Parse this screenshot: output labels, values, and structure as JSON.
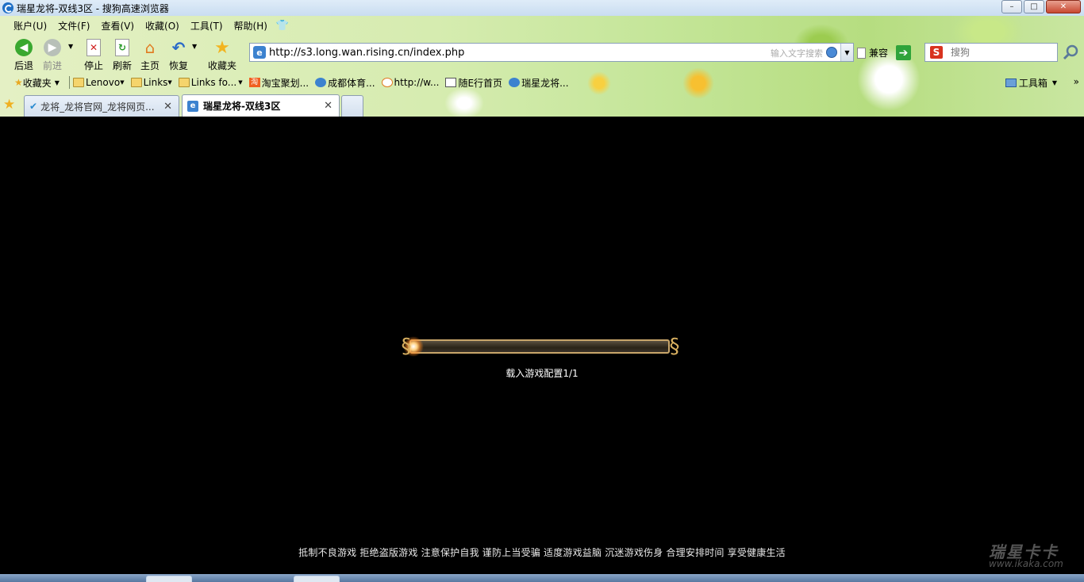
{
  "window": {
    "title": "瑞星龙将-双线3区 - 搜狗高速浏览器",
    "min_label": "–",
    "max_label": "□",
    "close_label": "✕"
  },
  "menu": [
    "账户(U)",
    "文件(F)",
    "查看(V)",
    "收藏(O)",
    "工具(T)",
    "帮助(H)"
  ],
  "nav": {
    "back": "后退",
    "forward": "前进",
    "stop": "停止",
    "refresh": "刷新",
    "home": "主页",
    "restore": "恢复",
    "favorites": "收藏夹"
  },
  "address": {
    "url": "http://s3.long.wan.rising.cn/index.php",
    "search_hint": "输入文字搜索"
  },
  "compat_label": "兼容",
  "search": {
    "placeholder": "搜狗",
    "logo": "S"
  },
  "bookmarks": {
    "favorites": "收藏夹",
    "items": [
      "Lenovo",
      "Links",
      "Links fo...",
      "淘宝聚划...",
      "成都体育...",
      "http://w...",
      "随E行首页",
      "瑞星龙将..."
    ],
    "toolbox": "工具箱"
  },
  "tabs": [
    {
      "label": "龙将_龙将官网_龙将网页..."
    },
    {
      "label": "瑞星龙将-双线3区"
    }
  ],
  "game": {
    "progress": 0.0,
    "loading_text": "载入游戏配置1/1",
    "health_notice": "抵制不良游戏  拒绝盗版游戏  注意保护自我  谨防上当受骗  适度游戏益脑  沉迷游戏伤身  合理安排时间  享受健康生活"
  },
  "watermark": {
    "title": "瑞星卡卡",
    "url": "www.ikaka.com"
  },
  "colors": {
    "loader_border": "#c9a66a",
    "content_bg": "#000000",
    "go_button": "#2fa33a"
  }
}
